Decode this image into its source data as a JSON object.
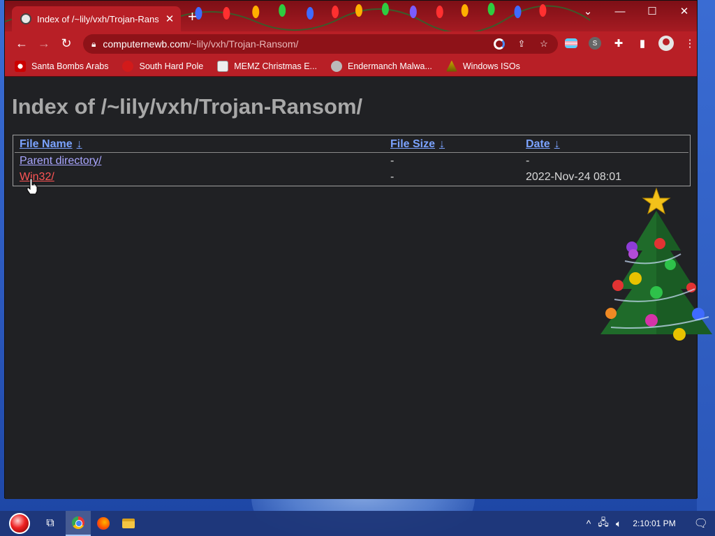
{
  "browser": {
    "tab": {
      "title": "Index of /~lily/vxh/Trojan-Ransom/",
      "close_icon": "close-icon"
    },
    "window_controls": [
      "chevron-down-icon",
      "minimize-icon",
      "maximize-icon",
      "close-icon"
    ],
    "address": {
      "host": "computernewb.com",
      "path": "/~lily/vxh/Trojan-Ransom/"
    },
    "bookmarks": [
      {
        "label": "Santa Bombs Arabs",
        "icon": "santa-icon"
      },
      {
        "label": "South Hard Pole",
        "icon": "ornament-icon"
      },
      {
        "label": "MEMZ Christmas E...",
        "icon": "image-icon"
      },
      {
        "label": "Endermanch Malwa...",
        "icon": "raccoon-icon"
      },
      {
        "label": "Windows ISOs",
        "icon": "tree-icon"
      }
    ],
    "theme_colors": {
      "frame": "#a61b22",
      "toolbar": "#b81f26",
      "omnibox": "#8e1218"
    }
  },
  "page": {
    "heading": "Index of /~lily/vxh/Trojan-Ransom/",
    "columns": {
      "name": "File Name",
      "size": "File Size",
      "date": "Date",
      "sort_arrow": "↓"
    },
    "rows": [
      {
        "name": "Parent directory/",
        "size": "-",
        "date": "-"
      },
      {
        "name": "Win32/",
        "size": "-",
        "date": "2022-Nov-24 08:01"
      }
    ]
  },
  "taskbar": {
    "apps": [
      "start-orb-icon",
      "task-view-icon",
      "chrome-icon",
      "firefox-icon",
      "file-explorer-icon"
    ],
    "clock": "2:10:01 PM"
  }
}
